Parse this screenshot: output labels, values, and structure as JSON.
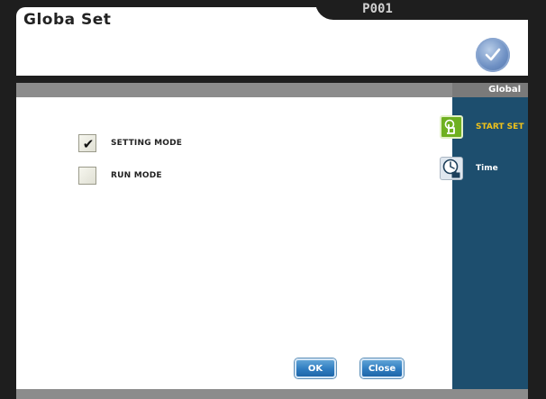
{
  "window": {
    "title": "Globa Set",
    "page_code": "P001"
  },
  "header": {
    "confirm_icon": "check-circle-icon"
  },
  "sidebar": {
    "heading": "Global",
    "items": [
      {
        "label": "START SET",
        "icon": "touch-hand-icon",
        "active": true,
        "color": "#f0c21a"
      },
      {
        "label": "Time",
        "icon": "clock-hand-icon",
        "active": false,
        "color": "#ffffff"
      }
    ]
  },
  "options": [
    {
      "label": "SETTING MODE",
      "checked": true
    },
    {
      "label": "RUN MODE",
      "checked": false
    }
  ],
  "buttons": {
    "ok_label": "OK",
    "close_label": "Close"
  },
  "colors": {
    "sidebar_bg": "#1d4e6e",
    "accent_active": "#f0c21a",
    "button_blue": "#2f7cc0"
  }
}
